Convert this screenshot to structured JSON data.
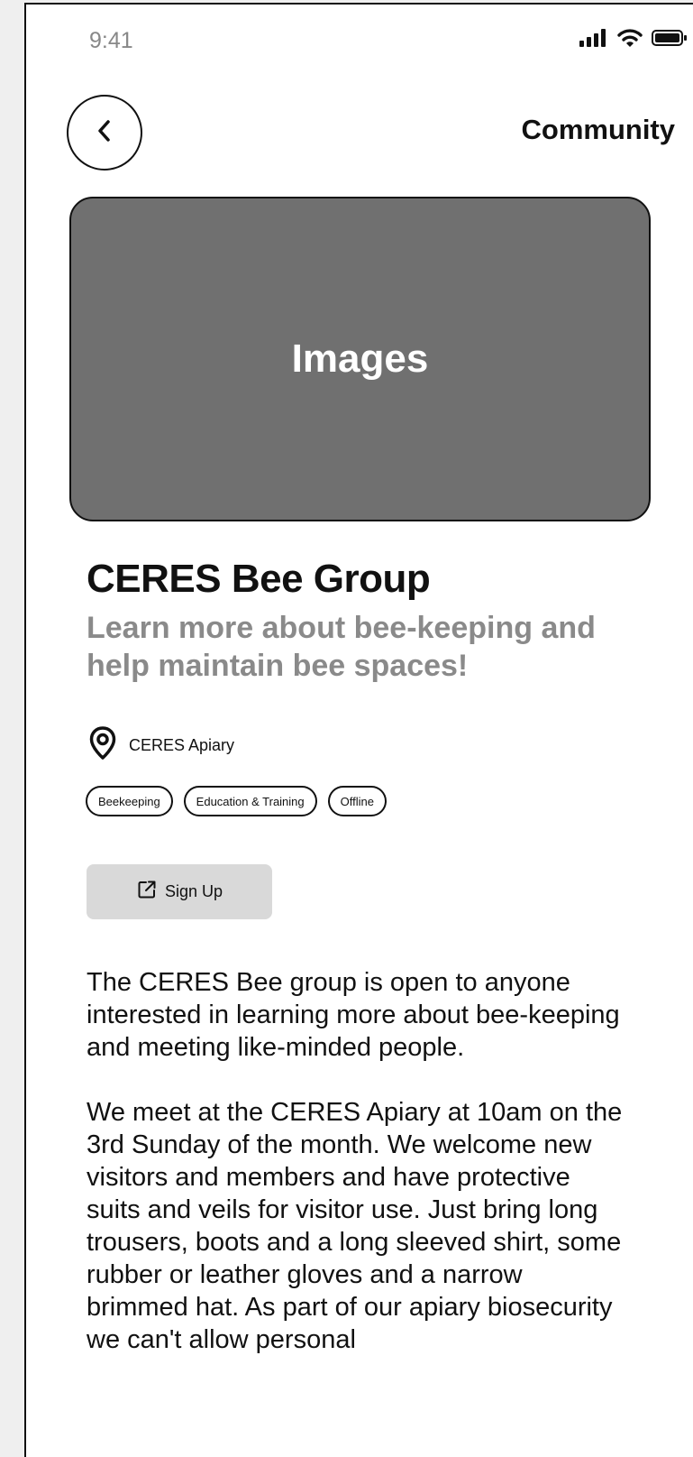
{
  "status_bar": {
    "time": "9:41"
  },
  "header": {
    "title": "Community"
  },
  "hero": {
    "label": "Images"
  },
  "group": {
    "title": "CERES Bee Group",
    "subtitle": "Learn more about bee-keeping and help maintain bee spaces!",
    "location": "CERES Apiary",
    "tags": [
      "Beekeeping",
      "Education & Training",
      "Offline"
    ]
  },
  "actions": {
    "signup_label": "Sign Up"
  },
  "description": {
    "paragraphs": [
      "The CERES Bee group is open to anyone interested in learning more about bee-keeping and meeting like-minded people.",
      "We meet at the CERES Apiary at 10am on the 3rd Sunday of the month. We welcome new visitors and members and have protective suits and veils for visitor use. Just bring long trousers, boots and a long sleeved shirt, some rubber or leather gloves and a narrow brimmed hat. As part of our apiary biosecurity we can't allow personal"
    ]
  },
  "colors": {
    "image_placeholder": "#707070",
    "subtitle": "#8a8a8a",
    "button_bg": "#d9d9d9"
  }
}
